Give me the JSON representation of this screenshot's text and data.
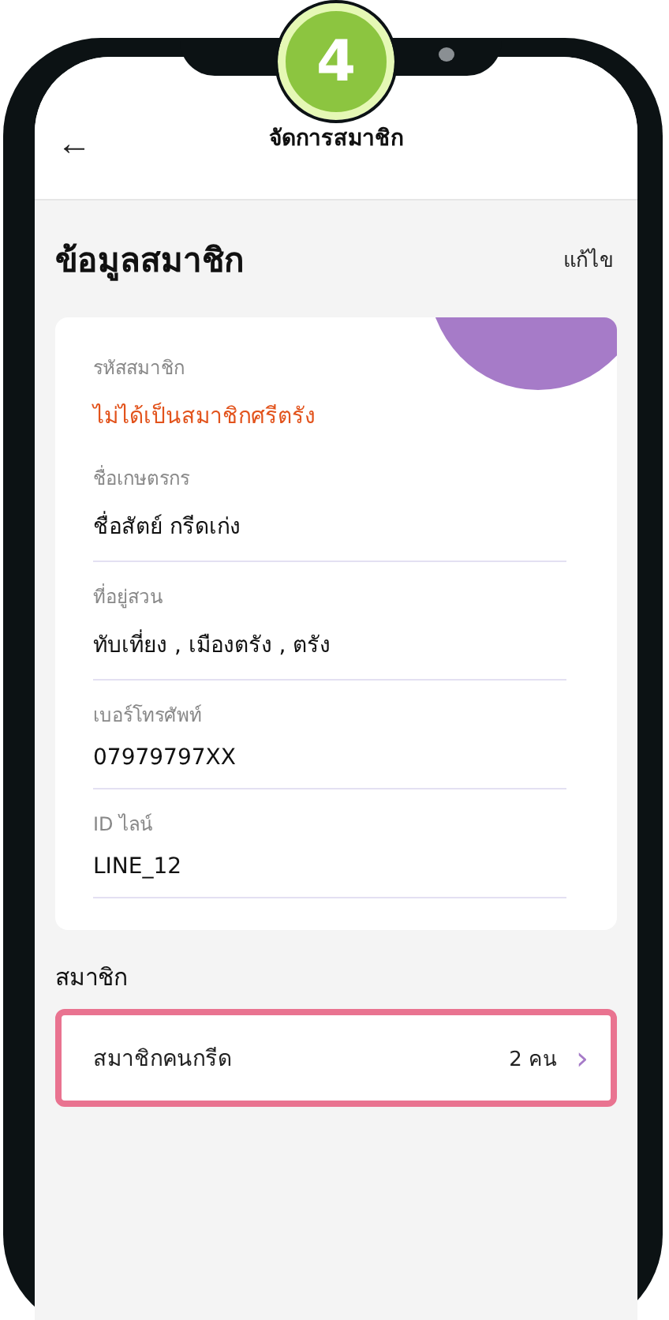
{
  "step_badge": "4",
  "header": {
    "back_icon": "←",
    "title": "จัดการสมาชิก"
  },
  "section": {
    "title": "ข้อมูลสมาชิก",
    "action": "แก้ไข"
  },
  "fields": [
    {
      "label": "รหัสสมาชิก",
      "value": "ไม่ได้เป็นสมาชิกศรีตรัง",
      "kind": "status"
    },
    {
      "label": "ชื่อเกษตรกร",
      "value": "ชื่อสัตย์ กรีดเก่ง",
      "kind": "text"
    },
    {
      "label": "ที่อยู่สวน",
      "value": "ทับเที่ยง , เมืองตรัง , ตรัง",
      "kind": "text"
    },
    {
      "label": "เบอร์โทรศัพท์",
      "value": "07979797XX",
      "kind": "text"
    },
    {
      "label": "ID ไลน์",
      "value": "LINE_12",
      "kind": "text"
    }
  ],
  "members": {
    "title": "สมาชิก",
    "row": {
      "label": "สมาชิกคนกรีด",
      "count": "2 คน",
      "chevron": "›",
      "highlighted": true
    }
  }
}
